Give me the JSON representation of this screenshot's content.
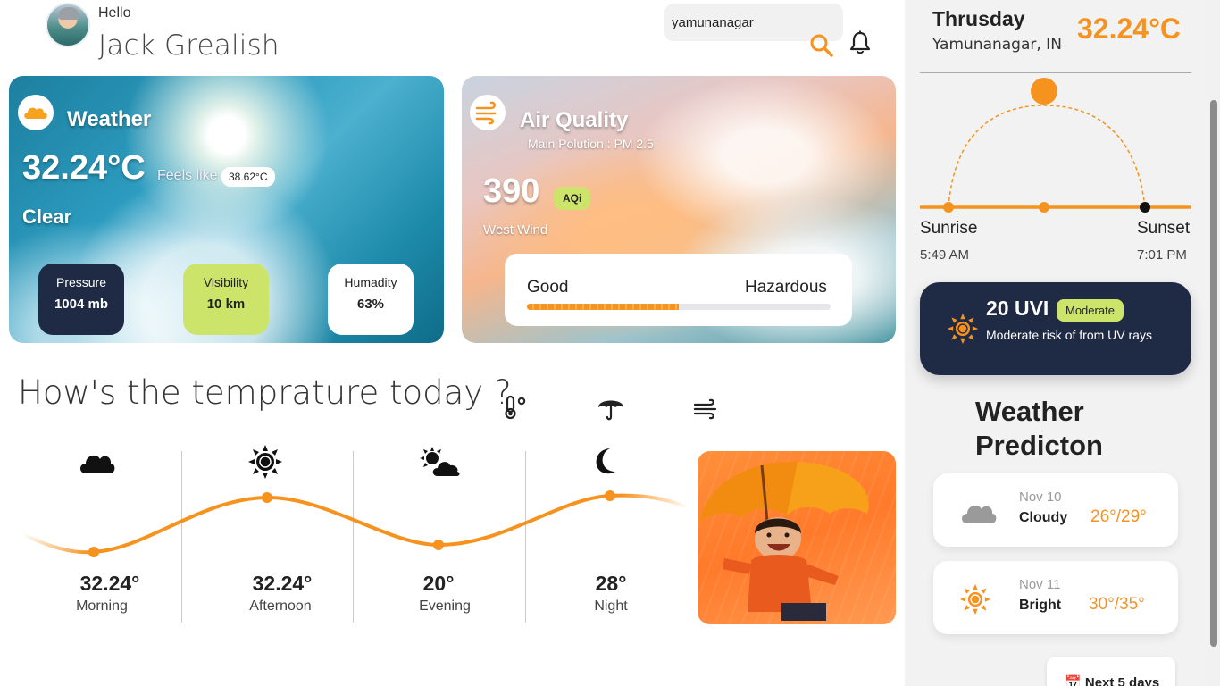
{
  "header": {
    "greeting": "Hello",
    "user_name": "Jack Grealish",
    "search_value": "yamunanagar"
  },
  "weather_card": {
    "title": "Weather",
    "temperature": "32.24°C",
    "feels_like_label": "Feels like",
    "feels_like_value": "38.62°C",
    "condition": "Clear",
    "stats": [
      {
        "label": "Pressure",
        "value": "1004 mb"
      },
      {
        "label": "Visibility",
        "value": "10 km"
      },
      {
        "label": "Humadity",
        "value": "63%"
      }
    ]
  },
  "air_card": {
    "title": "Air Quality",
    "main_pollution": "Main Polution : PM 2.5",
    "aqi_value": "390",
    "aqi_badge": "AQi",
    "wind": "West Wind",
    "scale_low": "Good",
    "scale_high": "Hazardous",
    "scale_fraction": 0.5
  },
  "today": {
    "title": "How's the temprature today ?",
    "periods": [
      {
        "name": "Morning",
        "temp": "32.24°",
        "icon": "cloud-icon"
      },
      {
        "name": "Afternoon",
        "temp": "32.24°",
        "icon": "sun-icon"
      },
      {
        "name": "Evening",
        "temp": "20°",
        "icon": "partly-cloudy-icon"
      },
      {
        "name": "Night",
        "temp": "28°",
        "icon": "moon-icon"
      }
    ],
    "tabs": [
      "thermometer-icon",
      "umbrella-icon",
      "wind-icon"
    ]
  },
  "panel": {
    "day": "Thrusday",
    "location": "Yamunanagar, IN",
    "temperature": "32.24°C",
    "sunrise_label": "Sunrise",
    "sunrise_time": "5:49 AM",
    "sunset_label": "Sunset",
    "sunset_time": "7:01 PM",
    "uv_value": "20 UVI",
    "uv_level": "Moderate",
    "uv_text": "Moderate risk of from UV rays",
    "prediction_title_1": "Weather",
    "prediction_title_2": "Predicton",
    "predictions": [
      {
        "date": "Nov 10",
        "condition": "Cloudy",
        "temps": "26°/29°",
        "icon": "cloud-icon"
      },
      {
        "date": "Nov 11",
        "condition": "Bright",
        "temps": "30°/35°",
        "icon": "sun-icon"
      }
    ],
    "next_button": "Next 5 days"
  },
  "colors": {
    "accent": "#f6921e",
    "navy": "#1f2a44",
    "lime": "#cde46b"
  }
}
